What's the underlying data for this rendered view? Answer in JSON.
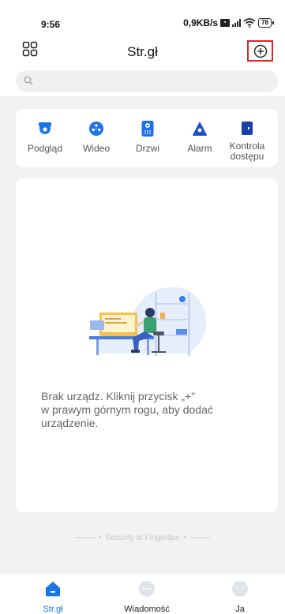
{
  "status_bar": {
    "time": "9:56",
    "network_speed": "0,9KB/s",
    "battery": "78"
  },
  "header": {
    "title": "Str.gł",
    "search": {
      "value": "",
      "placeholder": ""
    }
  },
  "quick_access": [
    {
      "label": "Podgląd",
      "icon": "camera-icon"
    },
    {
      "label": "Wideo",
      "icon": "video-reel-icon"
    },
    {
      "label": "Drzwi",
      "icon": "intercom-icon"
    },
    {
      "label": "Alarm",
      "icon": "alarm-icon"
    },
    {
      "label": "Kontrola\ndostępu",
      "icon": "access-control-icon"
    }
  ],
  "empty_state": {
    "message": "Brak urządz. Kliknij przycisk „+”\nw prawym górnym rogu, aby dodać\nurządzenie."
  },
  "footer": {
    "slogan": "Security at Fingertips"
  },
  "tabbar": [
    {
      "label": "Str.gł",
      "icon": "home-icon",
      "active": true
    },
    {
      "label": "Wiadomość",
      "icon": "message-icon",
      "active": false
    },
    {
      "label": "Ja",
      "icon": "profile-icon",
      "active": false
    }
  ],
  "colors": {
    "accent": "#1a73e8",
    "highlight_border": "#d9262a",
    "background": "#f2f2f5"
  }
}
